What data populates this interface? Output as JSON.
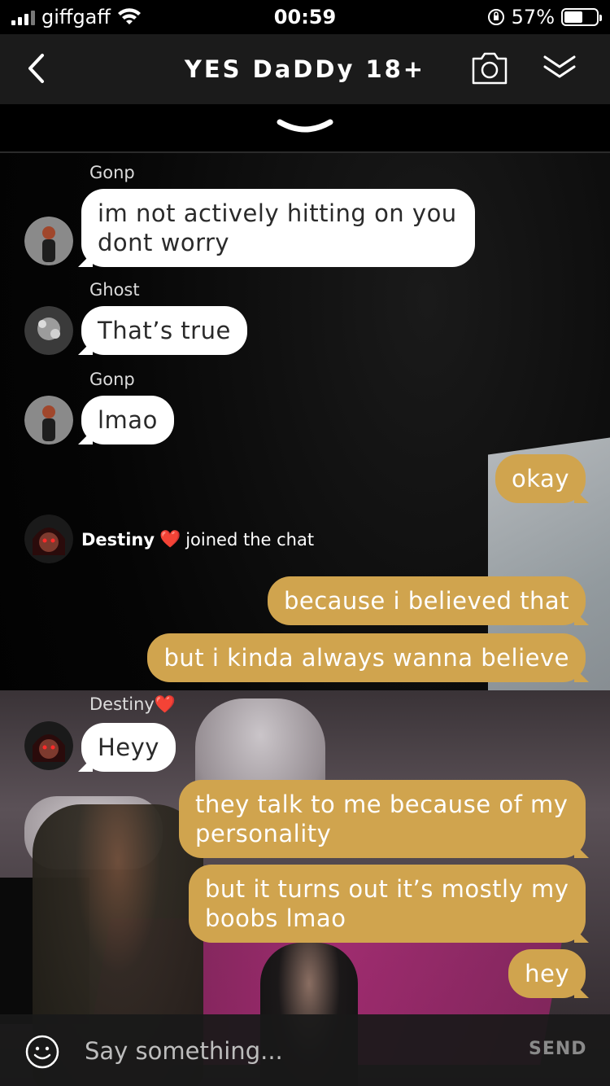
{
  "status_bar": {
    "carrier": "giffgaff",
    "time": "00:59",
    "battery_percent": "57%",
    "battery_level": 0.57
  },
  "header": {
    "title": "YES DaDDy 18+"
  },
  "messages": [
    {
      "type": "in",
      "sender": "Gonp",
      "text": "im not actively hitting on you dont worry"
    },
    {
      "type": "in",
      "sender": "Ghost",
      "text": "That’s true"
    },
    {
      "type": "in",
      "sender": "Gonp",
      "text": "lmao"
    },
    {
      "type": "out",
      "text": "okay"
    },
    {
      "type": "system",
      "name": "Destiny",
      "heart": "❤️",
      "text": "joined the chat"
    },
    {
      "type": "out",
      "text": "because i believed that"
    },
    {
      "type": "out",
      "text": "but i kinda always wanna believe"
    },
    {
      "type": "in",
      "sender": "Destiny",
      "heart": "❤️",
      "text": "Heyy"
    },
    {
      "type": "out",
      "text": "they talk to me because of my personality"
    },
    {
      "type": "out",
      "text": "but it turns out it’s mostly my boobs lmao"
    },
    {
      "type": "out",
      "text": "hey"
    }
  ],
  "input": {
    "placeholder": "Say something...",
    "send_label": "SEND"
  },
  "colors": {
    "outgoing_bubble": "#d0a44e",
    "incoming_bubble": "#ffffff",
    "header_bg": "#1b1b1b"
  },
  "icons": {
    "back": "chevron-left-icon",
    "camera": "camera-icon",
    "collapse": "double-chevron-down-icon",
    "emoji": "smiley-icon"
  }
}
